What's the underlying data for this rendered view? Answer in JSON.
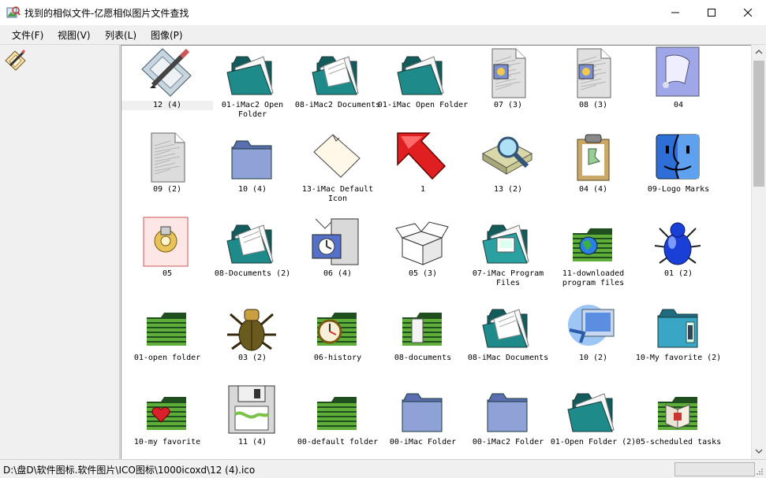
{
  "window": {
    "title": "找到的相似文件-亿愿相似图片文件查找",
    "icons": {
      "app": "image-search-app-icon",
      "minimize": "minimize-icon",
      "maximize": "maximize-icon",
      "close": "close-icon"
    }
  },
  "menu": [
    {
      "label": "文件(F)"
    },
    {
      "label": "视图(V)"
    },
    {
      "label": "列表(L)"
    },
    {
      "label": "图像(P)"
    }
  ],
  "toolbar": {
    "icon": "paint-edit-icon"
  },
  "gallery": {
    "selected_index": 0,
    "items": [
      {
        "label": "12 (4)",
        "icon": "pencil-document-icon"
      },
      {
        "label": "01-iMac2 Open Folder",
        "icon": "open-folder-icon"
      },
      {
        "label": "08-iMac2 Documents",
        "icon": "documents-folder-icon"
      },
      {
        "label": "01-iMac Open Folder",
        "icon": "open-folder-icon"
      },
      {
        "label": "07 (3)",
        "icon": "document-icon"
      },
      {
        "label": "08 (3)",
        "icon": "document-icon"
      },
      {
        "label": "04",
        "icon": "scroll-document-icon"
      },
      {
        "label": "09 (2)",
        "icon": "blank-document-icon"
      },
      {
        "label": "10 (4)",
        "icon": "folder-icon"
      },
      {
        "label": "13-iMac Default Icon",
        "icon": "default-document-icon"
      },
      {
        "label": "1",
        "icon": "red-arrow-icon"
      },
      {
        "label": "13 (2)",
        "icon": "scanner-magnifier-icon"
      },
      {
        "label": "04 (4)",
        "icon": "clipboard-icon"
      },
      {
        "label": "09-Logo Marks",
        "icon": "finder-face-icon"
      },
      {
        "label": "05",
        "icon": "gear-document-icon"
      },
      {
        "label": "08-Documents (2)",
        "icon": "documents-folder-icon"
      },
      {
        "label": "06 (4)",
        "icon": "computer-icon"
      },
      {
        "label": "05 (3)",
        "icon": "open-box-icon"
      },
      {
        "label": "07-iMac Program Files",
        "icon": "program-folder-icon"
      },
      {
        "label": "11-downloaded program files",
        "icon": "globe-folder-icon"
      },
      {
        "label": "01 (2)",
        "icon": "blue-bug-icon"
      },
      {
        "label": "01-open folder",
        "icon": "green-folder-icon"
      },
      {
        "label": "03 (2)",
        "icon": "beetle-icon"
      },
      {
        "label": "06-history",
        "icon": "clock-folder-icon"
      },
      {
        "label": "08-documents",
        "icon": "green-documents-folder-icon"
      },
      {
        "label": "08-iMac Documents",
        "icon": "documents-folder-icon"
      },
      {
        "label": "10 (2)",
        "icon": "network-computer-icon"
      },
      {
        "label": "10-My favorite (2)",
        "icon": "favorite-folder-icon"
      },
      {
        "label": "10-my favorite",
        "icon": "heart-folder-icon"
      },
      {
        "label": "11 (4)",
        "icon": "floppy-disk-icon"
      },
      {
        "label": "00-default folder",
        "icon": "green-folder-icon"
      },
      {
        "label": "00-iMac Folder",
        "icon": "folder-icon"
      },
      {
        "label": "00-iMac2 Folder",
        "icon": "folder-icon"
      },
      {
        "label": "01-Open Folder (2)",
        "icon": "open-folder-icon"
      },
      {
        "label": "05-scheduled tasks",
        "icon": "book-folder-icon"
      }
    ]
  },
  "status": {
    "path": "D:\\盘D\\软件图标.软件图片\\ICO图标\\1000icoxd\\12 (4).ico"
  }
}
